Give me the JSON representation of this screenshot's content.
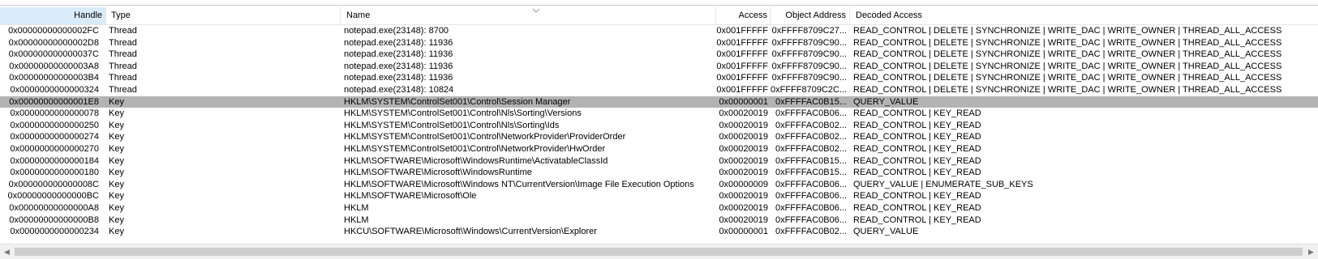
{
  "columns": {
    "handle": "Handle",
    "type": "Type",
    "name": "Name",
    "access": "Access",
    "object_address": "Object Address",
    "decoded_access": "Decoded Access"
  },
  "rows": [
    {
      "handle": "0x00000000000002FC",
      "type": "Thread",
      "name": "notepad.exe(23148): 8700",
      "access": "0x001FFFFF",
      "object_address": "0xFFFF8709C27...",
      "decoded_access": "READ_CONTROL | DELETE | SYNCHRONIZE | WRITE_DAC | WRITE_OWNER | THREAD_ALL_ACCESS"
    },
    {
      "handle": "0x00000000000002D8",
      "type": "Thread",
      "name": "notepad.exe(23148): 11936",
      "access": "0x001FFFFF",
      "object_address": "0xFFFF8709C90...",
      "decoded_access": "READ_CONTROL | DELETE | SYNCHRONIZE | WRITE_DAC | WRITE_OWNER | THREAD_ALL_ACCESS"
    },
    {
      "handle": "0x000000000000037C",
      "type": "Thread",
      "name": "notepad.exe(23148): 11936",
      "access": "0x001FFFFF",
      "object_address": "0xFFFF8709C90...",
      "decoded_access": "READ_CONTROL | DELETE | SYNCHRONIZE | WRITE_DAC | WRITE_OWNER | THREAD_ALL_ACCESS"
    },
    {
      "handle": "0x00000000000003A8",
      "type": "Thread",
      "name": "notepad.exe(23148): 11936",
      "access": "0x001FFFFF",
      "object_address": "0xFFFF8709C90...",
      "decoded_access": "READ_CONTROL | DELETE | SYNCHRONIZE | WRITE_DAC | WRITE_OWNER | THREAD_ALL_ACCESS"
    },
    {
      "handle": "0x00000000000003B4",
      "type": "Thread",
      "name": "notepad.exe(23148): 11936",
      "access": "0x001FFFFF",
      "object_address": "0xFFFF8709C90...",
      "decoded_access": "READ_CONTROL | DELETE | SYNCHRONIZE | WRITE_DAC | WRITE_OWNER | THREAD_ALL_ACCESS"
    },
    {
      "handle": "0x0000000000000324",
      "type": "Thread",
      "name": "notepad.exe(23148): 10824",
      "access": "0x001FFFFF",
      "object_address": "0xFFFF8709C2C...",
      "decoded_access": "READ_CONTROL | DELETE | SYNCHRONIZE | WRITE_DAC | WRITE_OWNER | THREAD_ALL_ACCESS"
    },
    {
      "handle": "0x00000000000001E8",
      "type": "Key",
      "name": "HKLM\\SYSTEM\\ControlSet001\\Control\\Session Manager",
      "access": "0x00000001",
      "object_address": "0xFFFFAC0B15...",
      "decoded_access": "QUERY_VALUE",
      "selected": true
    },
    {
      "handle": "0x0000000000000078",
      "type": "Key",
      "name": "HKLM\\SYSTEM\\ControlSet001\\Control\\Nls\\Sorting\\Versions",
      "access": "0x00020019",
      "object_address": "0xFFFFAC0B06...",
      "decoded_access": "READ_CONTROL | KEY_READ"
    },
    {
      "handle": "0x0000000000000250",
      "type": "Key",
      "name": "HKLM\\SYSTEM\\ControlSet001\\Control\\Nls\\Sorting\\Ids",
      "access": "0x00020019",
      "object_address": "0xFFFFAC0B02...",
      "decoded_access": "READ_CONTROL | KEY_READ"
    },
    {
      "handle": "0x0000000000000274",
      "type": "Key",
      "name": "HKLM\\SYSTEM\\ControlSet001\\Control\\NetworkProvider\\ProviderOrder",
      "access": "0x00020019",
      "object_address": "0xFFFFAC0B02...",
      "decoded_access": "READ_CONTROL | KEY_READ"
    },
    {
      "handle": "0x0000000000000270",
      "type": "Key",
      "name": "HKLM\\SYSTEM\\ControlSet001\\Control\\NetworkProvider\\HwOrder",
      "access": "0x00020019",
      "object_address": "0xFFFFAC0B02...",
      "decoded_access": "READ_CONTROL | KEY_READ"
    },
    {
      "handle": "0x0000000000000184",
      "type": "Key",
      "name": "HKLM\\SOFTWARE\\Microsoft\\WindowsRuntime\\ActivatableClassId",
      "access": "0x00020019",
      "object_address": "0xFFFFAC0B15...",
      "decoded_access": "READ_CONTROL | KEY_READ"
    },
    {
      "handle": "0x0000000000000180",
      "type": "Key",
      "name": "HKLM\\SOFTWARE\\Microsoft\\WindowsRuntime",
      "access": "0x00020019",
      "object_address": "0xFFFFAC0B15...",
      "decoded_access": "READ_CONTROL | KEY_READ"
    },
    {
      "handle": "0x000000000000008C",
      "type": "Key",
      "name": "HKLM\\SOFTWARE\\Microsoft\\Windows NT\\CurrentVersion\\Image File Execution Options",
      "access": "0x00000009",
      "object_address": "0xFFFFAC0B06...",
      "decoded_access": "QUERY_VALUE | ENUMERATE_SUB_KEYS"
    },
    {
      "handle": "0x00000000000000BC",
      "type": "Key",
      "name": "HKLM\\SOFTWARE\\Microsoft\\Ole",
      "access": "0x00020019",
      "object_address": "0xFFFFAC0B06...",
      "decoded_access": "READ_CONTROL | KEY_READ"
    },
    {
      "handle": "0x00000000000000A8",
      "type": "Key",
      "name": "HKLM",
      "access": "0x00020019",
      "object_address": "0xFFFFAC0B06...",
      "decoded_access": "READ_CONTROL | KEY_READ"
    },
    {
      "handle": "0x00000000000000B8",
      "type": "Key",
      "name": "HKLM",
      "access": "0x00020019",
      "object_address": "0xFFFFAC0B06...",
      "decoded_access": "READ_CONTROL | KEY_READ"
    },
    {
      "handle": "0x0000000000000234",
      "type": "Key",
      "name": "HKCU\\SOFTWARE\\Microsoft\\Windows\\CurrentVersion\\Explorer",
      "access": "0x00000001",
      "object_address": "0xFFFFAC0B02...",
      "decoded_access": "QUERY_VALUE"
    }
  ],
  "icons": {
    "sort": "chevron-down-icon",
    "scroll_left": "arrow-left-icon",
    "scroll_right": "arrow-right-icon"
  }
}
